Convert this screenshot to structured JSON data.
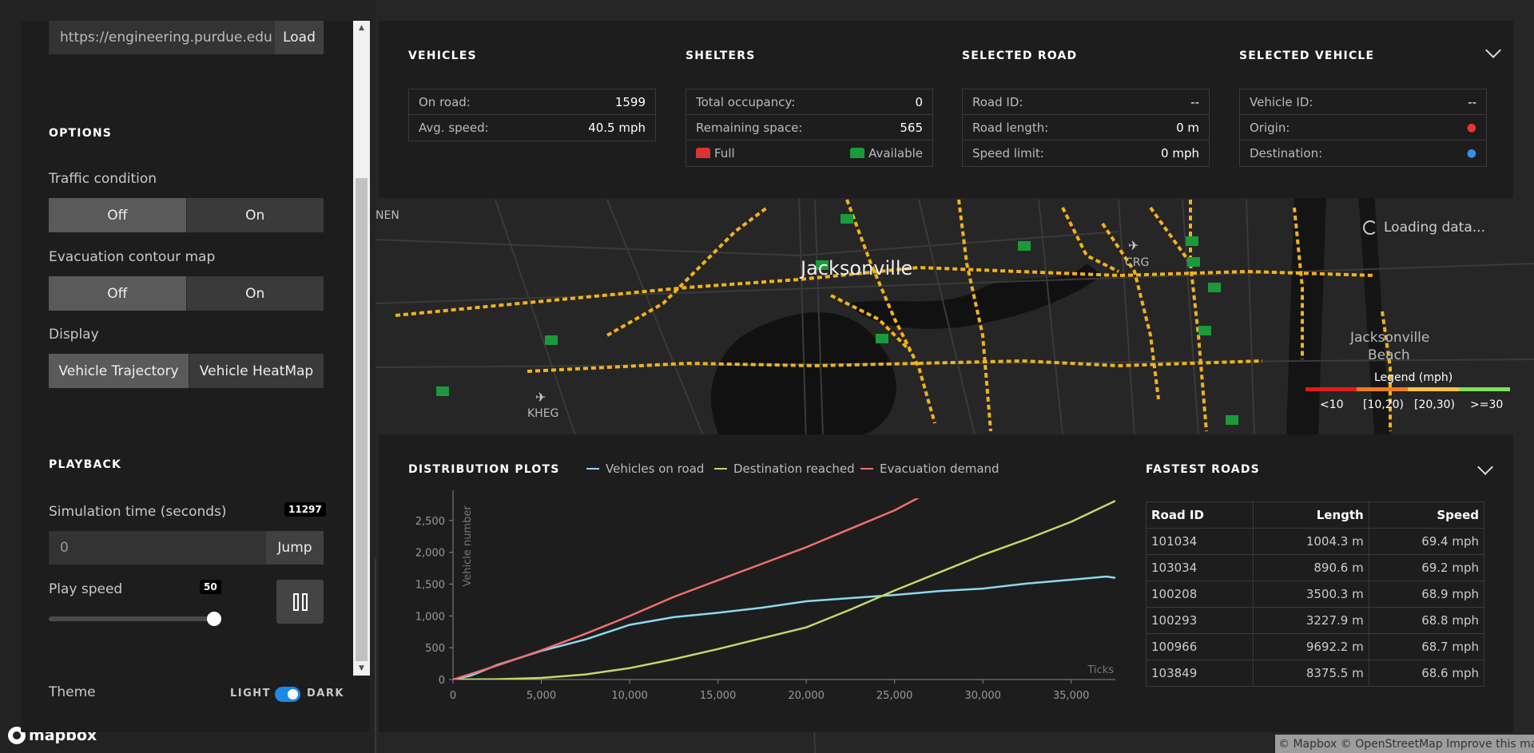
{
  "url_loader": {
    "value": "https://engineering.purdue.edu",
    "button": "Load"
  },
  "options": {
    "title": "OPTIONS",
    "traffic": {
      "label": "Traffic condition",
      "off": "Off",
      "on": "On",
      "selected": "Off"
    },
    "contour": {
      "label": "Evacuation contour map",
      "off": "Off",
      "on": "On",
      "selected": "Off"
    },
    "display": {
      "label": "Display",
      "trajectory": "Vehicle Trajectory",
      "heatmap": "Vehicle HeatMap",
      "selected": "Vehicle Trajectory"
    }
  },
  "playback": {
    "title": "PLAYBACK",
    "sim_time_label": "Simulation time (seconds)",
    "sim_time_badge": "11297",
    "sim_time_value": "0",
    "jump": "Jump",
    "play_speed_label": "Play speed",
    "play_speed_value": "50",
    "play_speed_fraction": 0.83
  },
  "theme": {
    "label": "Theme",
    "light": "LIGHT",
    "dark": "DARK",
    "selected": "DARK"
  },
  "vehicles": {
    "title": "VEHICLES",
    "on_road_label": "On road:",
    "on_road": "1599",
    "avg_speed_label": "Avg. speed:",
    "avg_speed": "40.5 mph"
  },
  "shelters": {
    "title": "SHELTERS",
    "occupancy_label": "Total occupancy:",
    "occupancy": "0",
    "remaining_label": "Remaining space:",
    "remaining": "565",
    "full": "Full",
    "available": "Available"
  },
  "selected_road": {
    "title": "SELECTED ROAD",
    "id_label": "Road ID:",
    "id": "--",
    "length_label": "Road length:",
    "length": "0 m",
    "speed_label": "Speed limit:",
    "speed": "0 mph"
  },
  "selected_vehicle": {
    "title": "SELECTED VEHICLE",
    "id_label": "Vehicle ID:",
    "id": "--",
    "origin_label": "Origin:",
    "destination_label": "Destination:"
  },
  "map": {
    "city": "Jacksonville",
    "beach": "Jacksonville",
    "beach2": "Beach",
    "airport_nen": "NEN",
    "airport_crg": "CRG",
    "airport_kheg": "KHEG",
    "loading": "Loading data...",
    "legend_title": "Legend (mph)",
    "legend": [
      {
        "label": "<10",
        "color": "#e31a1c"
      },
      {
        "label": "[10,20)",
        "color": "#f07c1d"
      },
      {
        "label": "[20,30)",
        "color": "#f5c542"
      },
      {
        "label": ">=30",
        "color": "#7be35a"
      }
    ],
    "mapbox": "mapbox",
    "attribution": "© Mapbox © OpenStreetMap Improve this map"
  },
  "distribution": {
    "title": "DISTRIBUTION PLOTS",
    "legend": {
      "vehicles": "Vehicles on road",
      "destination": "Destination reached",
      "demand": "Evacuation demand"
    }
  },
  "chart_data": {
    "type": "line",
    "xlabel": "Ticks",
    "ylabel": "Vehicle number",
    "xlim": [
      0,
      37500
    ],
    "ylim": [
      0,
      2850
    ],
    "x_ticks": [
      0,
      5000,
      10000,
      15000,
      20000,
      25000,
      30000,
      35000
    ],
    "x_tick_labels": [
      "0",
      "5,000",
      "10,000",
      "15,000",
      "20,000",
      "25,000",
      "30,000",
      "35,000"
    ],
    "y_ticks": [
      0,
      500,
      1000,
      1500,
      2000,
      2500
    ],
    "y_tick_labels": [
      "0",
      "500",
      "1,000",
      "1,500",
      "2,000",
      "2,500"
    ],
    "series": [
      {
        "name": "Vehicles on road",
        "color": "#8fd8f0",
        "x": [
          0,
          1000,
          2500,
          5000,
          7500,
          10000,
          12500,
          15000,
          17500,
          20000,
          22500,
          25000,
          27500,
          30000,
          32500,
          35000,
          37000,
          37500
        ],
        "values": [
          0,
          60,
          230,
          450,
          630,
          860,
          980,
          1050,
          1130,
          1230,
          1280,
          1330,
          1390,
          1430,
          1510,
          1570,
          1620,
          1600
        ]
      },
      {
        "name": "Destination reached",
        "color": "#c4d86a",
        "x": [
          0,
          2500,
          5000,
          7500,
          10000,
          12500,
          15000,
          17500,
          20000,
          22500,
          25000,
          27500,
          30000,
          32500,
          35000,
          37500
        ],
        "values": [
          0,
          5,
          25,
          80,
          180,
          320,
          480,
          650,
          820,
          1100,
          1400,
          1680,
          1960,
          2210,
          2480,
          2810
        ]
      },
      {
        "name": "Evacuation demand",
        "color": "#f07070",
        "x": [
          0,
          2500,
          5000,
          7500,
          10000,
          12500,
          15000,
          17500,
          20000,
          22500,
          25000,
          26500
        ],
        "values": [
          0,
          220,
          460,
          720,
          1000,
          1300,
          1560,
          1820,
          2080,
          2370,
          2660,
          2880
        ]
      }
    ]
  },
  "fastest_roads": {
    "title": "FASTEST ROADS",
    "headers": [
      "Road ID",
      "Length",
      "Speed"
    ],
    "rows": [
      [
        "101034",
        "1004.3 m",
        "69.4 mph"
      ],
      [
        "103034",
        "890.6 m",
        "69.2 mph"
      ],
      [
        "100208",
        "3500.3 m",
        "68.9 mph"
      ],
      [
        "100293",
        "3227.9 m",
        "68.8 mph"
      ],
      [
        "100966",
        "9692.2 m",
        "68.7 mph"
      ],
      [
        "103849",
        "8375.5 m",
        "68.6 mph"
      ]
    ]
  },
  "colors": {
    "shelter_full": "#d33",
    "shelter_available": "#1a9a3a",
    "toggle": "#1e88e5"
  }
}
